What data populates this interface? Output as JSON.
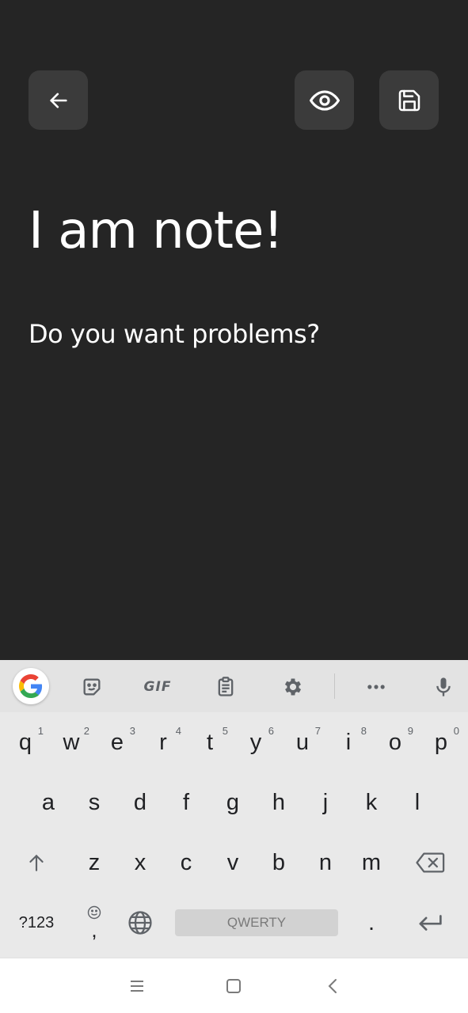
{
  "editor": {
    "title": "I am note!",
    "body": "Do you want problems?"
  },
  "icons": {
    "back": "arrow-left-icon",
    "preview": "eye-icon",
    "save": "floppy-disk-icon"
  },
  "colors": {
    "background": "#252525",
    "button_bg": "#3b3b3b",
    "text": "#ffffff",
    "keyboard_bg": "#e9e9e9"
  },
  "keyboard": {
    "toolbar": {
      "gif_label": "GIF"
    },
    "row1": [
      {
        "key": "q",
        "hint": "1"
      },
      {
        "key": "w",
        "hint": "2"
      },
      {
        "key": "e",
        "hint": "3"
      },
      {
        "key": "r",
        "hint": "4"
      },
      {
        "key": "t",
        "hint": "5"
      },
      {
        "key": "y",
        "hint": "6"
      },
      {
        "key": "u",
        "hint": "7"
      },
      {
        "key": "i",
        "hint": "8"
      },
      {
        "key": "o",
        "hint": "9"
      },
      {
        "key": "p",
        "hint": "0"
      }
    ],
    "row2": [
      "a",
      "s",
      "d",
      "f",
      "g",
      "h",
      "j",
      "k",
      "l"
    ],
    "row3": [
      "z",
      "x",
      "c",
      "v",
      "b",
      "n",
      "m"
    ],
    "symbols_label": "?123",
    "space_label": "QWERTY",
    "comma_label": ",",
    "period_label": "."
  }
}
